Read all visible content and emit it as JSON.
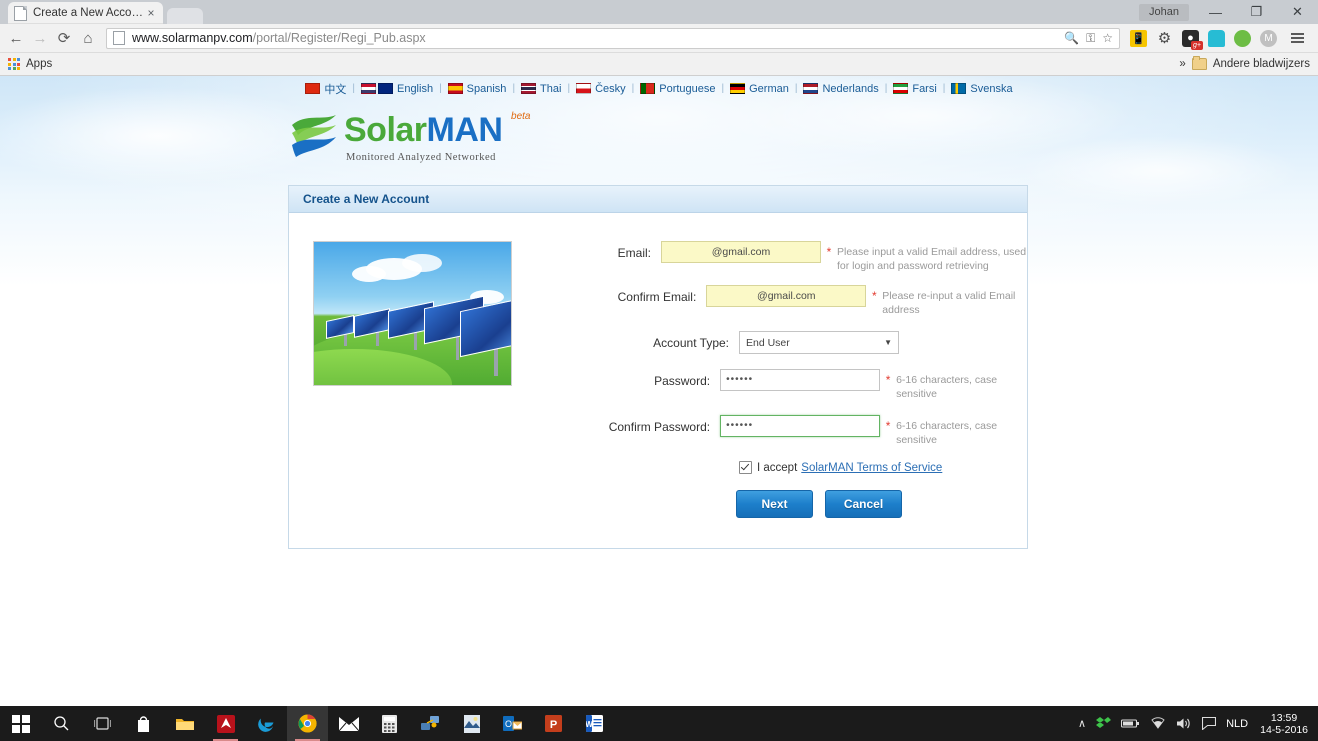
{
  "browser": {
    "tab": {
      "title": "Create a New Account",
      "favicon": "page-icon",
      "close": "×"
    },
    "window": {
      "user": "Johan",
      "minimize": "—",
      "maximize": "❐",
      "close": "✕"
    },
    "nav": {
      "back": "←",
      "forward": "→",
      "reload": "⟳",
      "home": "⌂"
    },
    "omnibox": {
      "url_domain": "www.solarmanpv.com",
      "url_path": "/portal/Register/Regi_Pub.aspx",
      "zoom_icon": "zoom-out-icon",
      "key_icon": "password-key-icon",
      "star_icon": "☆"
    },
    "extensions": [
      {
        "name": "phone-cast-icon",
        "glyph": "☎"
      },
      {
        "name": "gear-icon",
        "glyph": "⚙"
      },
      {
        "name": "google-plus-icon",
        "glyph": "●",
        "badge": "g+"
      },
      {
        "name": "robot-icon",
        "glyph": "■"
      },
      {
        "name": "hangouts-icon",
        "glyph": "●"
      },
      {
        "name": "m-circle-icon",
        "glyph": "M"
      }
    ],
    "bookmarks": {
      "apps_label": "Apps",
      "overflow": "»",
      "other_label": "Andere bladwijzers"
    }
  },
  "page": {
    "languages": [
      {
        "label": "中文",
        "flag": "#de2910"
      },
      {
        "label": "English",
        "flag": "#c8102e"
      },
      {
        "label": "Spanish",
        "flag": "#f1bf00"
      },
      {
        "label": "Thai",
        "flag": "#a51931"
      },
      {
        "label": "Česky",
        "flag": "#11457e"
      },
      {
        "label": "Portuguese",
        "flag": "#da291c"
      },
      {
        "label": "German",
        "flag": "#ffce00"
      },
      {
        "label": "Nederlands",
        "flag": "#21468b"
      },
      {
        "label": "Farsi",
        "flag": "#da0000"
      },
      {
        "label": "Svenska",
        "flag": "#006aa7"
      }
    ],
    "separator": "|",
    "logo": {
      "solar": "Solar",
      "man": "MAN",
      "beta": "beta",
      "tagline": "Monitored  Analyzed  Networked"
    },
    "panel": {
      "heading": "Create a New Account",
      "promo_alt": "solar-panels-photo",
      "fields": [
        {
          "label": "Email:",
          "value": "@gmail.com",
          "placeholder": "",
          "required": "*",
          "hint": "Please input a valid Email address, used for login and password retrieving",
          "state": "autofill"
        },
        {
          "label": "Confirm Email:",
          "value": "@gmail.com",
          "placeholder": "",
          "required": "*",
          "hint": "Please re-input a valid Email address",
          "state": "autofill"
        },
        {
          "label": "Account Type:",
          "value": "End User",
          "required": "",
          "hint": "",
          "state": "select",
          "caret": "▼"
        },
        {
          "label": "Password:",
          "value": "••••••",
          "required": "*",
          "hint": "6-16 characters, case sensitive",
          "state": "normal"
        },
        {
          "label": "Confirm Password:",
          "value": "••••••",
          "required": "*",
          "hint": "6-16 characters, case sensitive",
          "state": "focus"
        }
      ],
      "accept": {
        "checked": true,
        "text": "I accept",
        "link": "SolarMAN Terms of Service"
      },
      "buttons": {
        "next": "Next",
        "cancel": "Cancel"
      }
    }
  },
  "taskbar": {
    "start": "windows-start-icon",
    "items": [
      {
        "name": "search-icon"
      },
      {
        "name": "task-view-icon"
      },
      {
        "name": "store-icon"
      },
      {
        "name": "file-explorer-icon"
      },
      {
        "name": "avast-icon"
      },
      {
        "name": "edge-icon"
      },
      {
        "name": "chrome-icon"
      },
      {
        "name": "mail-icon"
      },
      {
        "name": "calculator-icon"
      },
      {
        "name": "network-share-icon"
      },
      {
        "name": "photo-icon"
      },
      {
        "name": "outlook-icon"
      },
      {
        "name": "powerpoint-icon"
      },
      {
        "name": "word-icon"
      }
    ],
    "tray": {
      "chevron": "∧",
      "dropbox": "dropbox-icon",
      "battery": "battery-icon",
      "wifi": "wifi-icon",
      "volume": "volume-icon",
      "action_center": "action-center-icon",
      "language": "NLD",
      "time": "13:59",
      "date": "14-5-2016"
    }
  }
}
